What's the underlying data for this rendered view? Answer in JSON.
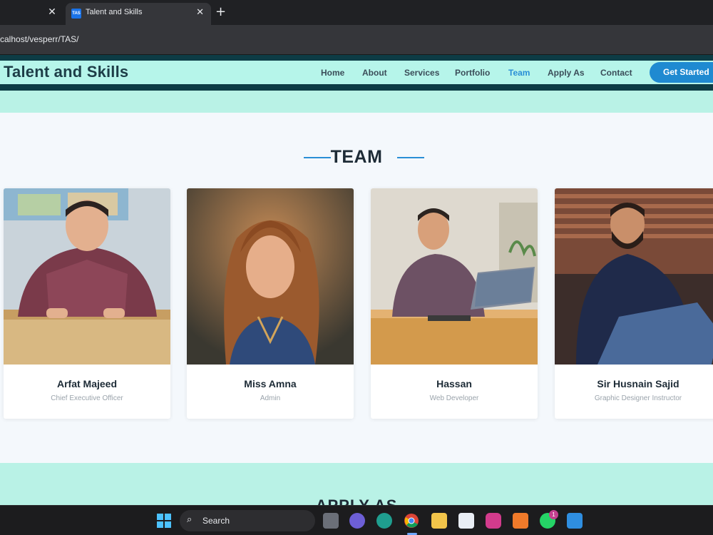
{
  "browser": {
    "tab_title": "Talent and Skills",
    "favicon_text": "TAS",
    "url": "calhost/vesperr/TAS/"
  },
  "site": {
    "brand": "Talent and Skills",
    "nav": [
      "Home",
      "About",
      "Services",
      "Portfolio",
      "Team",
      "Apply As",
      "Contact"
    ],
    "active_nav": "Team",
    "cta": "Get Started"
  },
  "team": {
    "title": "TEAM",
    "members": [
      {
        "name": "Arfat Majeed",
        "role": "Chief Executive Officer"
      },
      {
        "name": "Miss Amna",
        "role": "Admin"
      },
      {
        "name": "Hassan",
        "role": "Web Developer"
      },
      {
        "name": "Sir Husnain Sajid",
        "role": "Graphic Designer Instructor"
      }
    ]
  },
  "apply": {
    "heading": "APPLY AS"
  },
  "taskbar": {
    "search_label": "Search",
    "whatsapp_badge": "1",
    "icons": [
      "windows-start-icon",
      "search-icon",
      "task-view-icon",
      "teams-chat-icon",
      "edge-icon",
      "chrome-icon",
      "file-explorer-icon",
      "store-icon",
      "instagram-icon",
      "xampp-icon",
      "whatsapp-icon",
      "vscode-icon"
    ]
  },
  "colors": {
    "accent": "#2a8fd6",
    "header_bg": "#b6f5ea",
    "section_bg": "#f4f8fc",
    "cta_bg": "#1f8ad1"
  }
}
